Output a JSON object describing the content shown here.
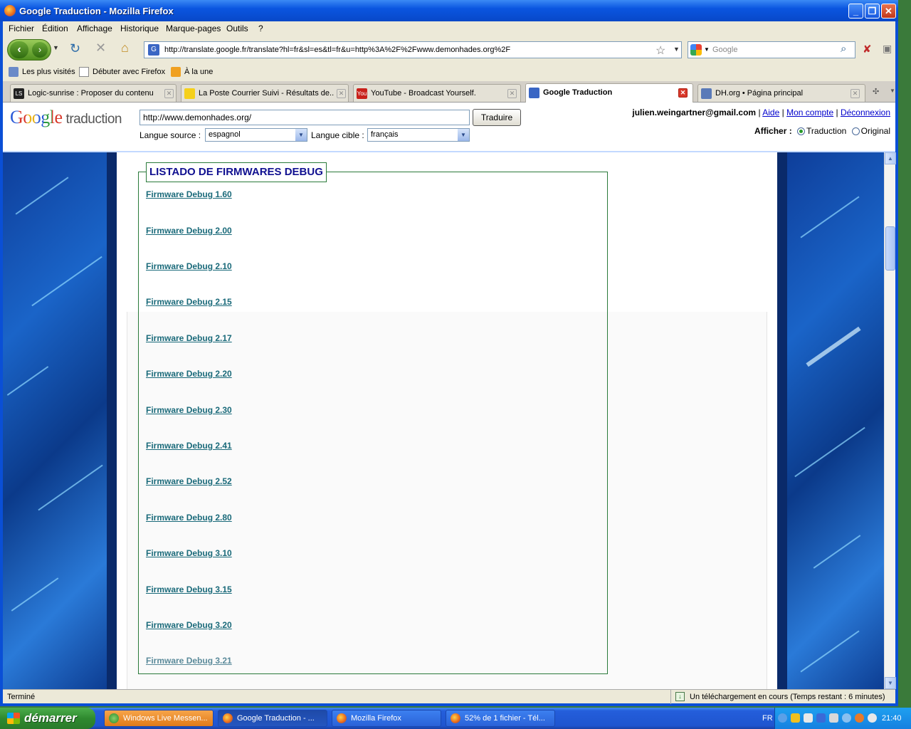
{
  "window": {
    "title": "Google Traduction - Mozilla Firefox"
  },
  "menu": [
    "Fichier",
    "Édition",
    "Affichage",
    "Historique",
    "Marque-pages",
    "Outils",
    "?"
  ],
  "nav": {
    "url": "http://translate.google.fr/translate?hl=fr&sl=es&tl=fr&u=http%3A%2F%2Fwww.demonhades.org%2F",
    "search_placeholder": "Google"
  },
  "bookmarks": [
    "Les plus visités",
    "Débuter avec Firefox",
    "À la une"
  ],
  "tabs": [
    {
      "label": "Logic-sunrise : Proposer du contenu",
      "fav": "LS"
    },
    {
      "label": "La Poste Courrier Suivi - Résultats de...",
      "fav": ""
    },
    {
      "label": "YouTube - Broadcast Yourself.",
      "fav": "You"
    },
    {
      "label": "Google Traduction",
      "fav": ""
    },
    {
      "label": "DH.org • Página principal",
      "fav": ""
    }
  ],
  "translate": {
    "logo_google": "Google",
    "logo_suffix": "traduction",
    "url_value": "http://www.demonhades.org/",
    "button": "Traduire",
    "source_label": "Langue source :",
    "source_value": "espagnol",
    "target_label": "Langue cible :",
    "target_value": "français",
    "email": "julien.weingartner@gmail.com",
    "sep": "|",
    "help": "Aide",
    "account": "Mon compte",
    "logout": "Déconnexion",
    "show_label": "Afficher :",
    "opt_translation": "Traduction",
    "opt_original": "Original"
  },
  "content": {
    "legend": "LISTADO DE FIRMWARES DEBUG",
    "firmwares": [
      "Firmware Debug 1.60",
      "Firmware Debug 2.00",
      "Firmware Debug 2.10",
      "Firmware Debug 2.15",
      "Firmware Debug 2.17",
      "Firmware Debug 2.20",
      "Firmware Debug 2.30",
      "Firmware Debug 2.41",
      "Firmware Debug 2.52",
      "Firmware Debug 2.80",
      "Firmware Debug 3.10",
      "Firmware Debug 3.15",
      "Firmware Debug 3.20",
      "Firmware Debug 3.21"
    ]
  },
  "status": {
    "left": "Terminé",
    "download": "Un téléchargement en cours (Temps restant : 6 minutes)"
  },
  "taskbar": {
    "start": "démarrer",
    "tasks": [
      "Windows Live Messen...",
      "Google Traduction - ...",
      "Mozilla Firefox",
      "52% de 1 fichier - Tél..."
    ],
    "lang": "FR",
    "clock": "21:40"
  },
  "colors": {
    "title_blue": "#0a55e0",
    "link": "#1a6a7a",
    "legend": "#101090",
    "fieldset": "#2a7a3a"
  }
}
